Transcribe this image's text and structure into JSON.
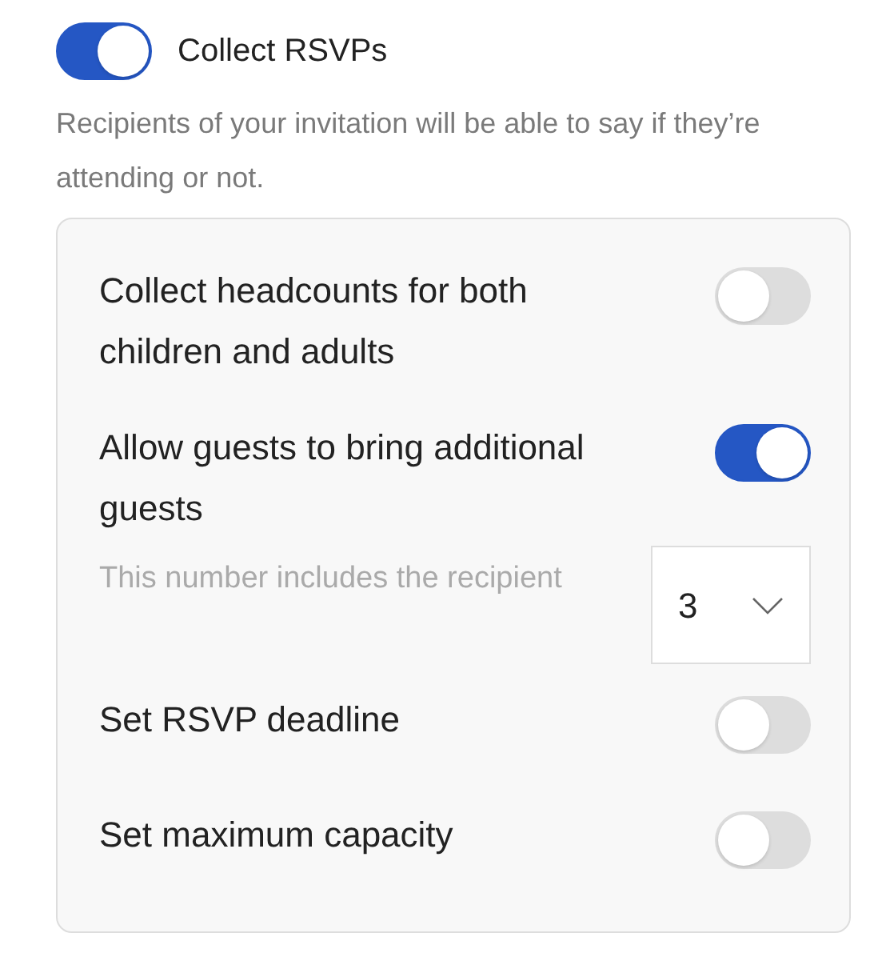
{
  "master": {
    "label": "Collect RSVPs",
    "on": true,
    "description": "Recipients of your invitation will be able to say if they’re attending or not."
  },
  "options": [
    {
      "label": "Collect headcounts for both children and adults",
      "on": false
    },
    {
      "label": "Allow guests to bring additional guests",
      "on": true,
      "note": "This number includes the recipient",
      "select": {
        "value": "3"
      }
    },
    {
      "label": "Set RSVP deadline",
      "on": false
    },
    {
      "label": "Set maximum capacity",
      "on": false
    }
  ]
}
